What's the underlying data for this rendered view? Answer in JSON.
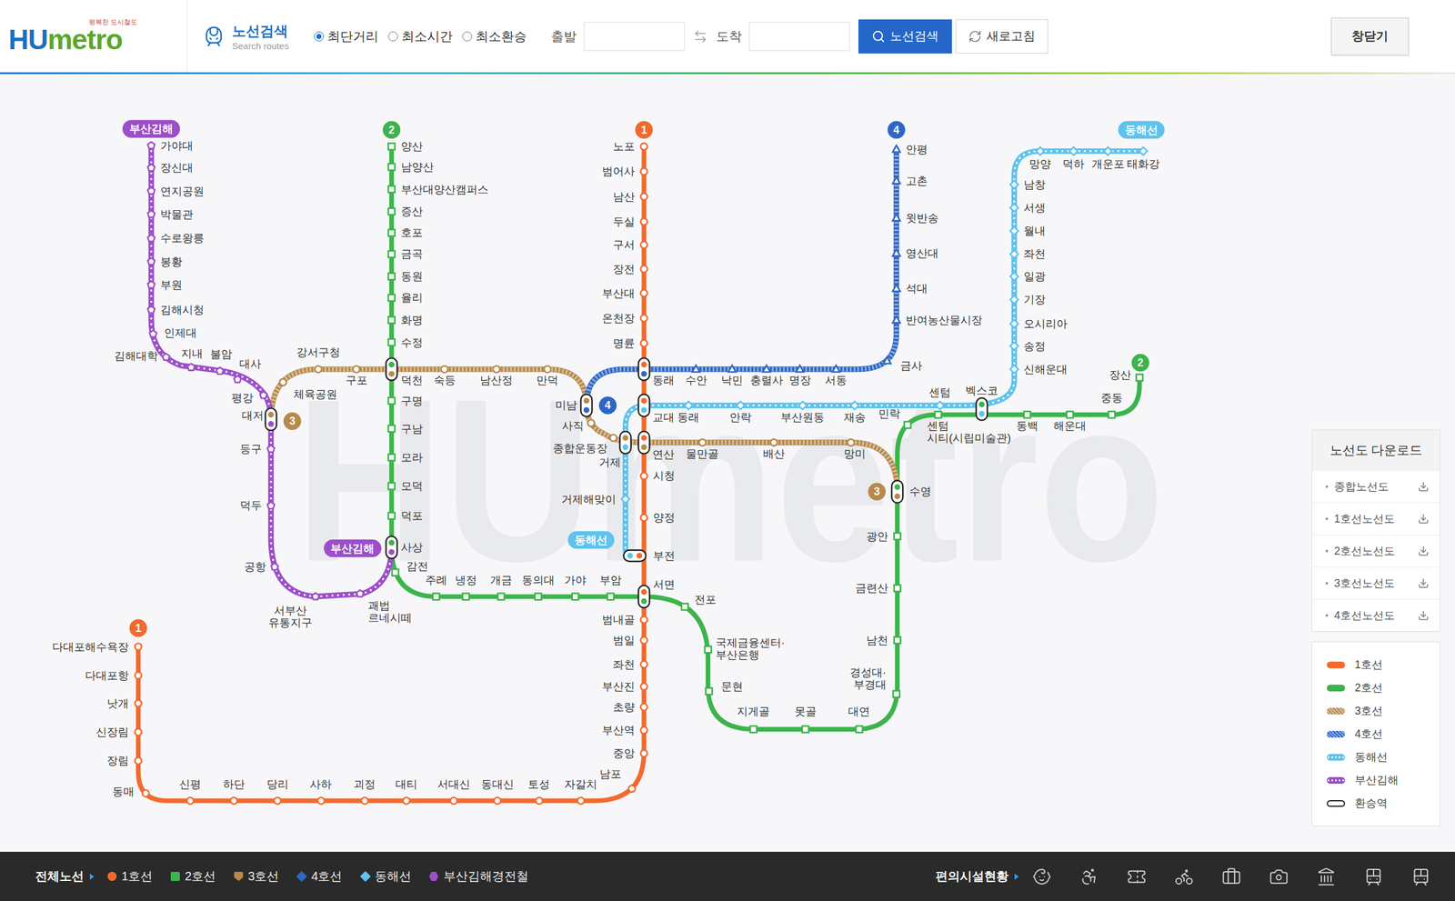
{
  "header": {
    "logo": {
      "first": "HU",
      "rest": "metro",
      "tagline": "행복한 도시철도"
    },
    "title": "노선검색",
    "subtitle": "Search routes",
    "options": [
      {
        "label": "최단거리",
        "selected": true
      },
      {
        "label": "최소시간",
        "selected": false
      },
      {
        "label": "최소환승",
        "selected": false
      }
    ],
    "from": {
      "label": "출발",
      "value": ""
    },
    "to": {
      "label": "도착",
      "value": ""
    },
    "searchButton": "노선검색",
    "refreshButton": "새로고침",
    "closeButton": "창닫기"
  },
  "map": {
    "watermark": "HUmetro",
    "lines": [
      {
        "badge": "1",
        "color": "#f26a2e",
        "kind": "solid",
        "stations": [
          "노포",
          "범어사",
          "남산",
          "두실",
          "구서",
          "장전",
          "부산대",
          "온천장",
          "명륜",
          "동래",
          "교대",
          "연산",
          "시청",
          "양정",
          "부전",
          "서면",
          "범내골",
          "범일",
          "좌천",
          "부산진",
          "초량",
          "부산역",
          "중앙",
          "남포",
          "자갈치",
          "토성",
          "동대신",
          "서대신",
          "대티",
          "괴정",
          "사하",
          "당리",
          "하단",
          "신평",
          "동매",
          "장림",
          "신장림",
          "낫개",
          "다대포항",
          "다대포해수욕장"
        ]
      },
      {
        "badge": "2",
        "color": "#3cb44b",
        "kind": "solid",
        "stations": [
          "양산",
          "남양산",
          "부산대양산캠퍼스",
          "증산",
          "호포",
          "금곡",
          "동원",
          "율리",
          "화명",
          "수정",
          "덕천",
          "구명",
          "구남",
          "모라",
          "모덕",
          "덕포",
          "사상",
          "감전",
          "주례",
          "냉정",
          "개금",
          "동의대",
          "가야",
          "부암",
          "전포",
          "국제금융센터·\n부산은행",
          "문현",
          "지게골",
          "못골",
          "대연",
          "경성대·\n부경대",
          "남천",
          "금련산",
          "광안",
          "수영",
          "민락",
          "센텀\n시티(시립미술관)",
          "벡스코",
          "동백",
          "해운대",
          "중동",
          "장산"
        ]
      },
      {
        "badge": "3",
        "color": "#b8894b",
        "kind": "striped",
        "stations": [
          "체육공원",
          "강서구청",
          "구포",
          "숙등",
          "남산정",
          "만덕",
          "미남",
          "사직",
          "종합운동장",
          "거제",
          "물만골",
          "배산",
          "망미"
        ]
      },
      {
        "badge": "4",
        "color": "#2f66c6",
        "kind": "striped",
        "stations": [
          "수안",
          "낙민",
          "충렬사",
          "명장",
          "서동",
          "금사",
          "반여농산물시장",
          "석대",
          "영산대",
          "윗반송",
          "고촌",
          "안평"
        ]
      },
      {
        "badge": "동해선",
        "color": "#5ec3ee",
        "kind": "dotted",
        "stations": [
          "거제해맞이",
          "동래",
          "안락",
          "부산원동",
          "재송",
          "센텀",
          "신해운대",
          "송정",
          "오시리아",
          "기장",
          "일광",
          "좌천",
          "월내",
          "서생",
          "남창",
          "망양",
          "덕하",
          "개운포",
          "태화강"
        ]
      },
      {
        "badge": "부산김해",
        "color": "#9c4fc9",
        "kind": "dotted",
        "stations": [
          "가야대",
          "장신대",
          "연지공원",
          "박물관",
          "수로왕릉",
          "봉황",
          "부원",
          "김해시청",
          "인제대",
          "김해대학",
          "지내",
          "불암",
          "대사",
          "평강",
          "대저",
          "등구",
          "덕두",
          "공항",
          "서부산\n유통지구",
          "괘법\n르네시떼"
        ]
      }
    ]
  },
  "download": {
    "title": "노선도 다운로드",
    "items": [
      "종합노선도",
      "1호선노선도",
      "2호선노선도",
      "3호선노선도",
      "4호선노선도"
    ]
  },
  "legend": [
    {
      "label": "1호선",
      "color": "#f26a2e",
      "kind": "solid"
    },
    {
      "label": "2호선",
      "color": "#3cb44b",
      "kind": "solid"
    },
    {
      "label": "3호선",
      "color": "#b8894b",
      "kind": "striped"
    },
    {
      "label": "4호선",
      "color": "#2f66c6",
      "kind": "striped"
    },
    {
      "label": "동해선",
      "color": "#5ec3ee",
      "kind": "dotted"
    },
    {
      "label": "부산김해",
      "color": "#9c4fc9",
      "kind": "dotted"
    },
    {
      "label": "환승역",
      "color": "#222222",
      "kind": "transfer"
    }
  ],
  "footer": {
    "allLines": "전체노선",
    "lines": [
      {
        "label": "1호선",
        "color": "#f26a2e",
        "kind": "circle"
      },
      {
        "label": "2호선",
        "color": "#3cb44b",
        "kind": "square"
      },
      {
        "label": "3호선",
        "color": "#b8894b",
        "kind": "shield"
      },
      {
        "label": "4호선",
        "color": "#2f66c6",
        "kind": "diamond"
      },
      {
        "label": "동해선",
        "color": "#5ec3ee",
        "kind": "diamond"
      },
      {
        "label": "부산김해경전철",
        "color": "#9c4fc9",
        "kind": "hexagon"
      }
    ],
    "facilities": "편의시설현황"
  }
}
